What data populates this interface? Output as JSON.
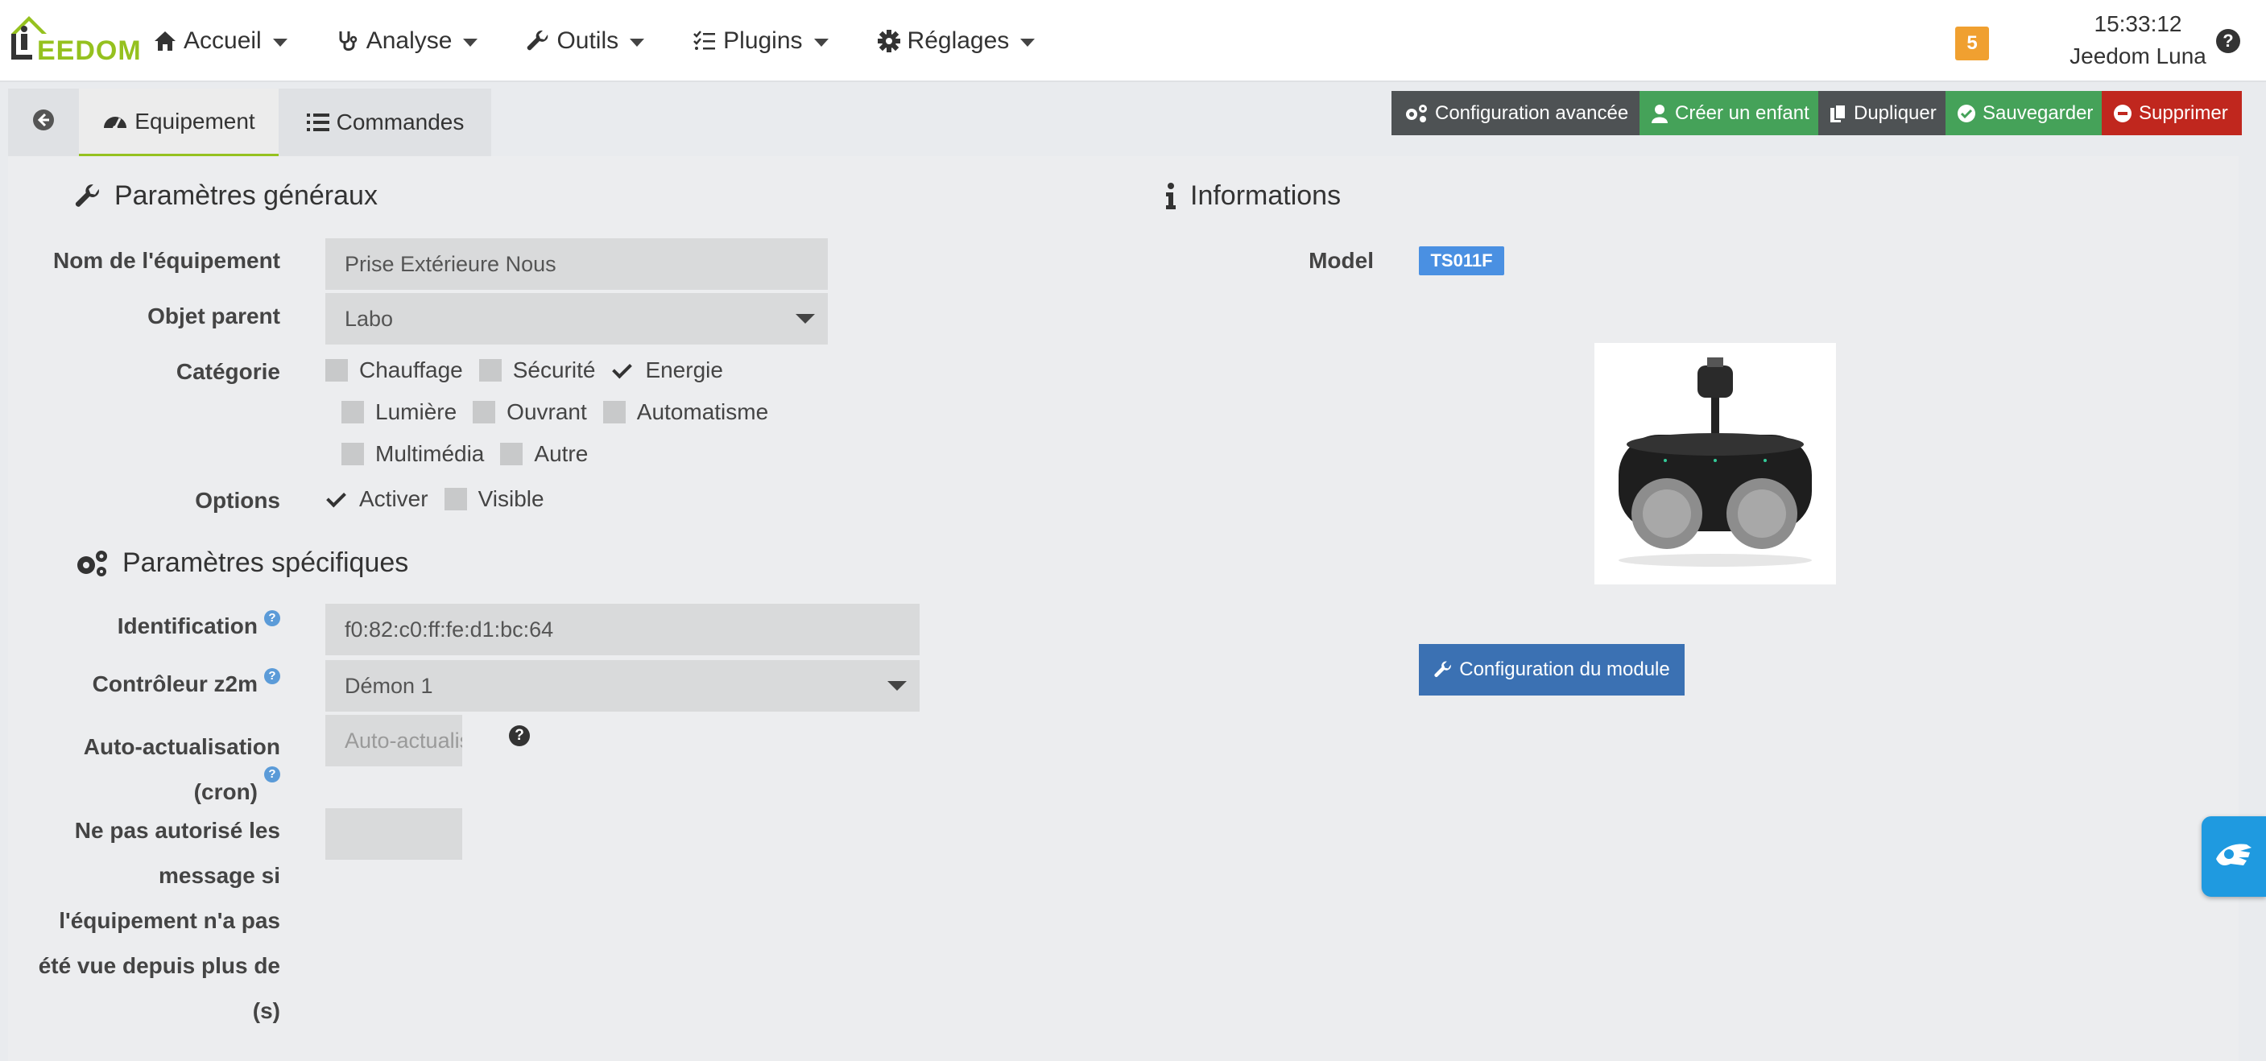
{
  "navbar": {
    "logo_text": "EEDOM",
    "menu": [
      {
        "label": "Accueil",
        "icon": "home-icon"
      },
      {
        "label": "Analyse",
        "icon": "stethoscope-icon"
      },
      {
        "label": "Outils",
        "icon": "wrench-icon"
      },
      {
        "label": "Plugins",
        "icon": "tasks-icon"
      },
      {
        "label": "Réglages",
        "icon": "cog-icon"
      }
    ],
    "notification_count": "5",
    "time": "15:33:12",
    "user": "Jeedom Luna",
    "help": "?"
  },
  "tabs": {
    "equipement": "Equipement",
    "commandes": "Commandes"
  },
  "actions": {
    "advanced": "Configuration avancée",
    "child": "Créer un enfant",
    "duplicate": "Dupliquer",
    "save": "Sauvegarder",
    "delete": "Supprimer"
  },
  "general": {
    "title": "Paramètres généraux",
    "name_label": "Nom de l'équipement",
    "name_value": "Prise Extérieure Nous",
    "parent_label": "Objet parent",
    "parent_value": "Labo",
    "category_label": "Catégorie",
    "categories": [
      {
        "label": "Chauffage",
        "checked": false
      },
      {
        "label": "Sécurité",
        "checked": false
      },
      {
        "label": "Energie",
        "checked": true
      },
      {
        "label": "Lumière",
        "checked": false
      },
      {
        "label": "Ouvrant",
        "checked": false
      },
      {
        "label": "Automatisme",
        "checked": false
      },
      {
        "label": "Multimédia",
        "checked": false
      },
      {
        "label": "Autre",
        "checked": false
      }
    ],
    "options_label": "Options",
    "options": [
      {
        "label": "Activer",
        "checked": true
      },
      {
        "label": "Visible",
        "checked": false
      }
    ]
  },
  "specific": {
    "title": "Paramètres spécifiques",
    "ident_label": "Identification",
    "ident_value": "f0:82:c0:ff:fe:d1:bc:64",
    "controller_label": "Contrôleur z2m",
    "controller_value": "Démon 1",
    "autorefresh_label_1": "Auto-actualisation",
    "autorefresh_label_2": "(cron)",
    "autorefresh_placeholder": "Auto-actualisation",
    "timeout_label_lines": [
      "Ne pas autorisé les",
      "message si",
      "l'équipement n'a pas",
      "été vue depuis plus de",
      "(s)"
    ],
    "timeout_value": ""
  },
  "info": {
    "title": "Informations",
    "model_label": "Model",
    "model_value": "TS011F",
    "config_module_button": "Configuration du module"
  },
  "colors": {
    "accent_green": "#95c11f",
    "save_green": "#45a259",
    "delete_red": "#c0271e",
    "module_blue": "#3b71b3",
    "badge_blue": "#4a90e2",
    "notif_orange": "#f0a030"
  }
}
